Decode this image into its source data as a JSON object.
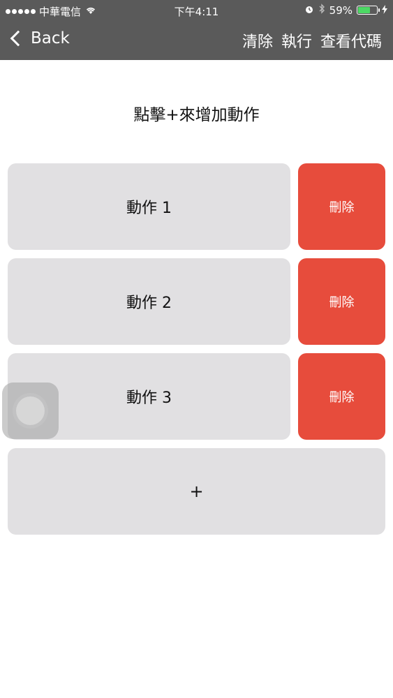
{
  "status_bar": {
    "carrier": "中華電信",
    "wifi_icon": "wifi-icon",
    "time": "下午4:11",
    "alarm_icon": "alarm-icon",
    "bluetooth_icon": "bluetooth-icon",
    "battery_percent": "59%",
    "battery_level": 0.59,
    "charging_icon": "lightning-icon"
  },
  "nav": {
    "back_label": "Back",
    "clear_label": "清除",
    "run_label": "執行",
    "view_code_label": "查看代碼"
  },
  "prompt": "點擊+來增加動作",
  "actions": [
    {
      "label": "動作 1",
      "delete_label": "刪除"
    },
    {
      "label": "動作 2",
      "delete_label": "刪除"
    },
    {
      "label": "動作 3",
      "delete_label": "刪除"
    }
  ],
  "add_button_label": "+",
  "colors": {
    "bar_bg": "#5a5a5a",
    "card_bg": "#e1e0e2",
    "delete_bg": "#e74c3c",
    "battery_fill": "#4cd964"
  }
}
